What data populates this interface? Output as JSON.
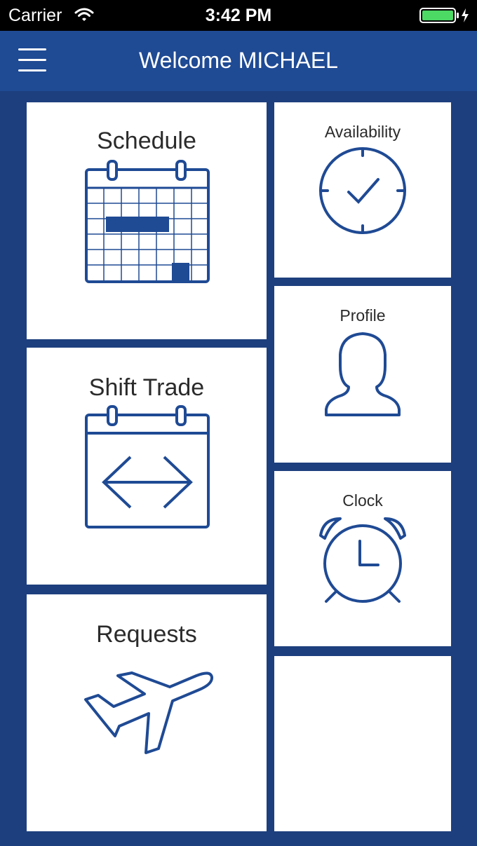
{
  "status_bar": {
    "carrier": "Carrier",
    "time": "3:42 PM"
  },
  "header": {
    "title": "Welcome MICHAEL",
    "menu_icon": "hamburger-menu-icon"
  },
  "tiles": {
    "schedule": {
      "label": "Schedule",
      "icon": "calendar-grid-icon"
    },
    "shift_trade": {
      "label": "Shift Trade",
      "icon": "calendar-swap-icon"
    },
    "requests": {
      "label": "Requests",
      "icon": "airplane-icon"
    },
    "availability": {
      "label": "Availability",
      "icon": "clock-check-icon"
    },
    "profile": {
      "label": "Profile",
      "icon": "person-icon"
    },
    "clock": {
      "label": "Clock",
      "icon": "alarm-clock-icon"
    },
    "empty": {
      "label": ""
    }
  },
  "colors": {
    "background": "#1d3f7e",
    "header": "#1f4a94",
    "icon": "#1f4a94",
    "battery": "#4cd964"
  }
}
